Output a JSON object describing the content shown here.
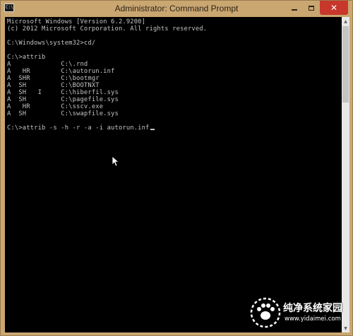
{
  "window": {
    "title": "Administrator: Command Prompt",
    "icon_label": "C:\\"
  },
  "controls": {
    "minimize_icon": "minimize-icon",
    "maximize_icon": "maximize-icon",
    "close_label": "✕"
  },
  "console": {
    "lines": [
      "Microsoft Windows [Version 6.2.9200]",
      "(c) 2012 Microsoft Corporation. All rights reserved.",
      "",
      "C:\\Windows\\system32>cd/",
      "",
      "C:\\>attrib",
      "A             C:\\.rnd",
      "A   HR        C:\\autorun.inf",
      "A  SHR        C:\\bootmgr",
      "A  SH         C:\\BOOTNXT",
      "A  SH   I     C:\\hiberfil.sys",
      "A  SH         C:\\pagefile.sys",
      "A   HR        C:\\sscv.exe",
      "A  SH         C:\\swapfile.sys",
      "",
      "C:\\>attrib -s -h -r -a -i autorun.inf"
    ]
  },
  "colors": {
    "console_bg": "#000000",
    "console_text": "#c4c4c4",
    "titlebar": "#caa671",
    "close_button": "#c7372b"
  },
  "watermark": {
    "name": "纯净系统家园",
    "url": "www.yidaimei.com"
  }
}
